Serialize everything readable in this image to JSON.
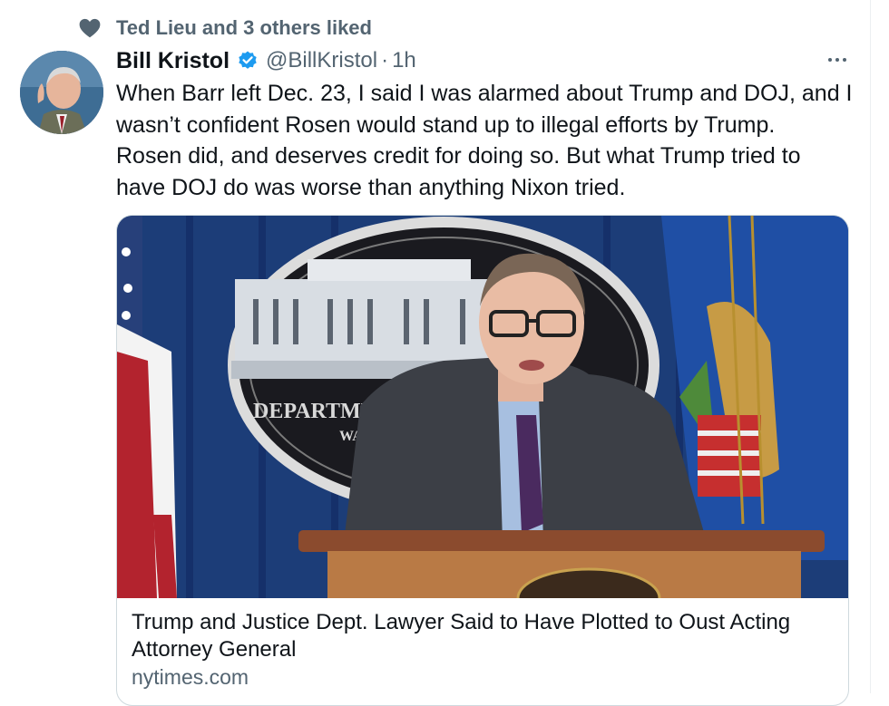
{
  "social_context": {
    "text": "Ted Lieu and 3 others liked"
  },
  "tweet": {
    "author": {
      "display_name": "Bill Kristol",
      "handle": "@BillKristol",
      "verified": true
    },
    "separator": "·",
    "time": "1h",
    "text": "When Barr left Dec. 23, I said I was alarmed about Trump and DOJ, and I\nwasn’t confident Rosen would stand up to illegal efforts by Trump.\nRosen did, and deserves credit for doing so. But what Trump tried to\nhave DOJ do was worse than anything Nixon tried."
  },
  "card": {
    "title": "Trump and Justice Dept. Lawyer Said to Have Plotted to Oust Acting Attorney General",
    "domain": "nytimes.com",
    "image_text": {
      "line1": "DEPARTMENT",
      "line2": "WASH"
    }
  },
  "icons": {
    "social_context": "heart-icon",
    "verified": "verified-badge-icon",
    "more": "more-icon"
  },
  "colors": {
    "secondary_text": "#536471",
    "verified_blue": "#1d9bf0",
    "text": "#0f1419"
  }
}
